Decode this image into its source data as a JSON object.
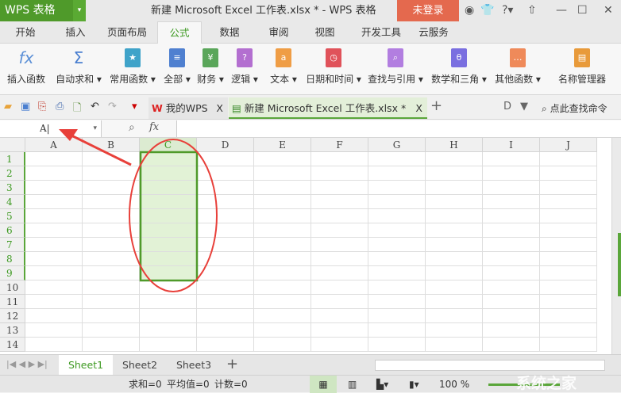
{
  "titlebar": {
    "app_button": "WPS 表格",
    "title": "新建 Microsoft Excel 工作表.xlsx * - WPS 表格",
    "login": "未登录"
  },
  "menu_tabs": [
    "开始",
    "插入",
    "页面布局",
    "公式",
    "数据",
    "审阅",
    "视图",
    "开发工具",
    "云服务"
  ],
  "active_tab": "公式",
  "ribbon": [
    {
      "label": "插入函数",
      "icon": "fx-icon",
      "color": "#5b8fd6",
      "glyph": "fx"
    },
    {
      "label": "自动求和 ▾",
      "icon": "sigma-icon",
      "color": "#4a7fd0",
      "glyph": "Σ"
    },
    {
      "label": "常用函数 ▾",
      "icon": "star-book-icon",
      "color": "#3fa3c9",
      "glyph": "★"
    },
    {
      "label": "全部 ▾",
      "icon": "list-book-icon",
      "color": "#4f80d0",
      "glyph": "≡"
    },
    {
      "label": "财务 ▾",
      "icon": "finance-book-icon",
      "color": "#5aa65a",
      "glyph": "¥"
    },
    {
      "label": "逻辑 ▾",
      "icon": "logic-book-icon",
      "color": "#b36fd0",
      "glyph": "?"
    },
    {
      "label": "文本 ▾",
      "icon": "text-book-icon",
      "color": "#ef9d45",
      "glyph": "a"
    },
    {
      "label": "日期和时间 ▾",
      "icon": "clock-book-icon",
      "color": "#e0525a",
      "glyph": "◷"
    },
    {
      "label": "查找与引用 ▾",
      "icon": "search-book-icon",
      "color": "#b27ee0",
      "glyph": "⌕"
    },
    {
      "label": "数学和三角 ▾",
      "icon": "math-book-icon",
      "color": "#7a6fe0",
      "glyph": "θ"
    },
    {
      "label": "其他函数 ▾",
      "icon": "more-book-icon",
      "color": "#ef8a5a",
      "glyph": "…"
    },
    {
      "label": "名称管理器",
      "icon": "name-manager-icon",
      "color": "#e89a3a",
      "glyph": "▤"
    }
  ],
  "doc_tabs": {
    "mywps": "我的WPS",
    "file": "新建 Microsoft Excel 工作表.xlsx *",
    "close": "X",
    "search": "点此查找命令"
  },
  "formula_bar": {
    "namebox": "A",
    "fx": "fx"
  },
  "columns": [
    "A",
    "B",
    "C",
    "D",
    "E",
    "F",
    "G",
    "H",
    "I",
    "J"
  ],
  "rows": [
    "1",
    "2",
    "3",
    "4",
    "5",
    "6",
    "7",
    "8",
    "9",
    "10",
    "11",
    "12",
    "13",
    "14"
  ],
  "selection": {
    "range": "C1:C9"
  },
  "sheets": [
    "Sheet1",
    "Sheet2",
    "Sheet3"
  ],
  "active_sheet": "Sheet1",
  "status": {
    "sum": "求和=0",
    "avg": "平均值=0",
    "count": "计数=0",
    "zoom": "100 %"
  },
  "watermark": "系统之家"
}
